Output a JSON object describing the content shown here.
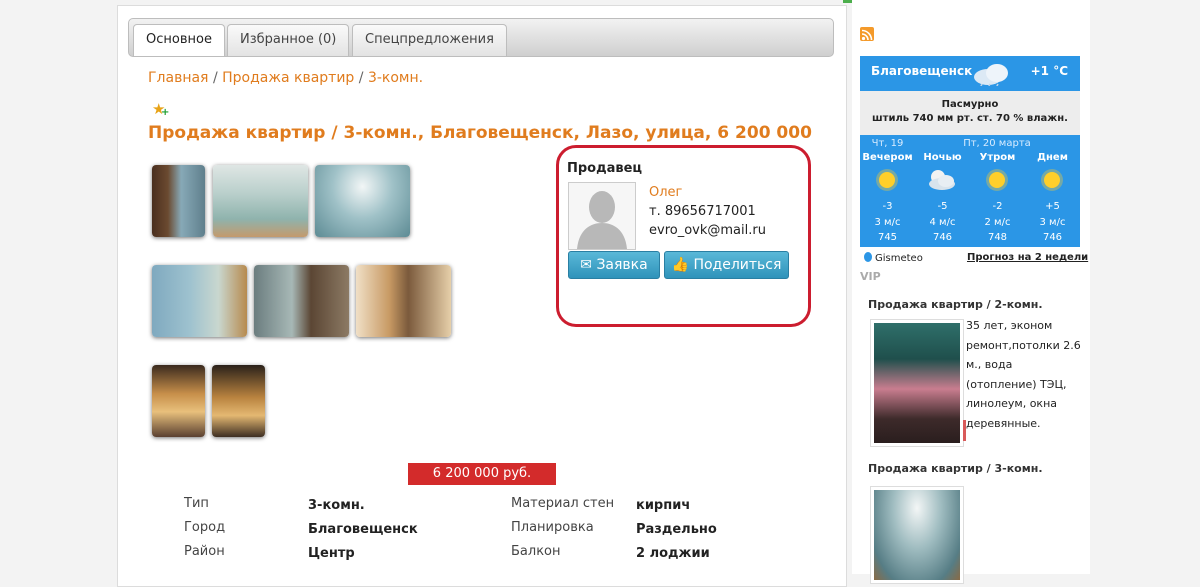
{
  "tabs": [
    {
      "label": "Основное",
      "active": true
    },
    {
      "label": "Избранное (0)",
      "active": false
    },
    {
      "label": "Спецпредложения",
      "active": false
    }
  ],
  "breadcrumb": {
    "home": "Главная",
    "sep": "/",
    "section": "Продажа квартир",
    "sub": "3-комн."
  },
  "listing": {
    "title": "Продажа квартир / 3-комн., Благовещенск, Лазо, улица, 6 200 000",
    "price": "6 200 000 руб."
  },
  "seller": {
    "heading": "Продавец",
    "name": "Олег",
    "phone": "т. 89656717001",
    "email": "evro_ovk@mail.ru",
    "request_button": "Заявка",
    "share_button": "Поделиться"
  },
  "details": {
    "left": [
      {
        "label": "Тип",
        "value": "3-комн."
      },
      {
        "label": "Город",
        "value": "Благовещенск"
      },
      {
        "label": "Район",
        "value": "Центр"
      }
    ],
    "right": [
      {
        "label": "Материал стен",
        "value": "кирпич"
      },
      {
        "label": "Планировка",
        "value": "Раздельно"
      },
      {
        "label": "Балкон",
        "value": "2 лоджии"
      }
    ]
  },
  "weather": {
    "city": "Благовещенск",
    "temp": "+1 °C",
    "condition": "Пасмурно",
    "stats": "штиль  740 мм рт. ст.  70 % влажн.",
    "day1": "Чт, 19",
    "day2": "Пт, 20 марта",
    "periods": [
      {
        "name": "Вечером",
        "temp": "-3",
        "wind": "3 м/с",
        "pressure": "745",
        "icon": "sun-icon"
      },
      {
        "name": "Ночью",
        "temp": "-5",
        "wind": "4 м/с",
        "pressure": "746",
        "icon": "cloud-moon-icon"
      },
      {
        "name": "Утром",
        "temp": "-2",
        "wind": "2 м/с",
        "pressure": "748",
        "icon": "sun-icon"
      },
      {
        "name": "Днем",
        "temp": "+5",
        "wind": "3 м/с",
        "pressure": "746",
        "icon": "sun-icon"
      }
    ],
    "provider": "Gismeteo",
    "forecast_link": "Прогноз на 2 недели"
  },
  "sidebar": {
    "vip": "VIP",
    "ads": [
      {
        "title": "Продажа квартир / 2-комн.",
        "text": "35 лет, эконом ремонт,потолки 2.6 м., вода (отопление) ТЭЦ, линолеум, окна деревянные."
      },
      {
        "title": "Продажа квартир / 3-комн.",
        "text": ""
      }
    ]
  },
  "colors": {
    "accent": "#e07c1e",
    "highlight_border": "#cc1d2f",
    "price_bg": "#d32b2b",
    "button": "#3a9ec4",
    "weather_blue": "#2b96e6"
  }
}
